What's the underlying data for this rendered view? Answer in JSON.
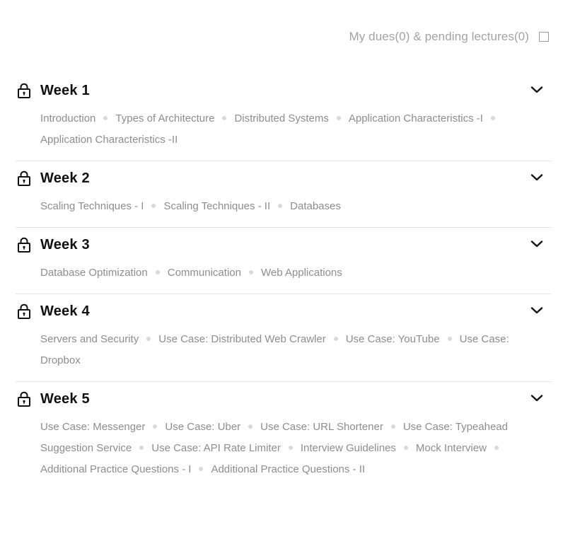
{
  "filter": {
    "label": "My dues(0) & pending lectures(0)",
    "checked": false
  },
  "weeks": [
    {
      "title": "Week 1",
      "topics": [
        "Introduction",
        "Types of Architecture",
        "Distributed Systems",
        "Application Characteristics -I",
        "Application Characteristics -II"
      ]
    },
    {
      "title": "Week 2",
      "topics": [
        "Scaling Techniques - I",
        "Scaling Techniques - II",
        "Databases"
      ]
    },
    {
      "title": "Week 3",
      "topics": [
        "Database Optimization",
        "Communication",
        "Web Applications"
      ]
    },
    {
      "title": "Week 4",
      "topics": [
        "Servers and Security",
        "Use Case: Distributed Web Crawler",
        "Use Case: YouTube",
        "Use Case: Dropbox"
      ]
    },
    {
      "title": "Week 5",
      "topics": [
        "Use Case: Messenger",
        "Use Case: Uber",
        "Use Case: URL Shortener",
        "Use Case: Typeahead Suggestion Service",
        "Use Case: API Rate Limiter",
        "Interview Guidelines",
        "Mock Interview",
        "Additional Practice Questions - I",
        "Additional Practice Questions - II"
      ]
    }
  ],
  "icons": {
    "lock": "lock-icon",
    "chevron": "chevron-down-icon"
  }
}
